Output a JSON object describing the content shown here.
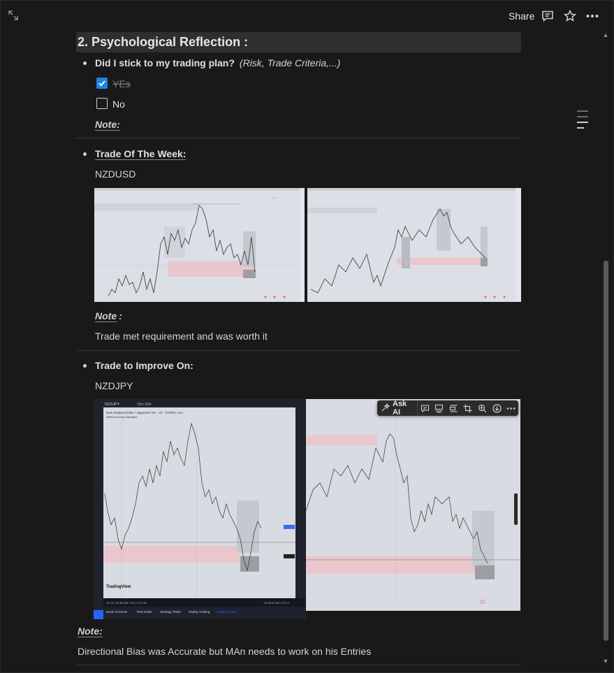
{
  "topbar": {
    "share_label": "Share",
    "icons": [
      "expand-icon",
      "comment-icon",
      "star-icon",
      "more-icon"
    ]
  },
  "section": {
    "heading": "2. Psychological Reflection :",
    "plan_question": {
      "label": "Did I stick to my trading plan?",
      "hint": "(Risk, Trade Criteria,...)"
    },
    "checklist": [
      {
        "label": "YEs",
        "checked": true
      },
      {
        "label": "No",
        "checked": false
      }
    ],
    "note1_label": "Note:",
    "trade_of_week": {
      "label": "Trade Of The Week:",
      "pair": "NZDUSD",
      "note_label": "Note",
      "note_colon": ":",
      "note_text": "Trade met requirement and was worth it"
    },
    "trade_to_improve": {
      "label": "Trade to Improve On:",
      "pair": "NZDJPY",
      "note_label": "Note:",
      "note_text": "Directional Bias was Accurate but MAn needs to work on his Entries"
    }
  },
  "image_toolbar": {
    "ask_ai_label": "Ask AI",
    "buttons": [
      "comment-icon",
      "caption-icon",
      "align-icon",
      "crop-icon",
      "zoom-icon",
      "download-icon",
      "more-icon"
    ]
  },
  "chart_screens": {
    "tv_symbol": "NZDJPY",
    "tv_title": "New Zealand Dollar / Japanese Yen · 1h · FOREX.com",
    "tv_subtitle": "Week and Day Separator",
    "tv_logo": "TradingView",
    "tv_bottom_tabs": [
      "Stock Screener",
      "Pine Editor",
      "Strategy Tester",
      "Replay Trading",
      "Trading Panel"
    ],
    "tv_timeframes": "1D  5D  1M  3M  6M  YTD  1Y  5Y  All",
    "tv_time": "09:38:40 AM UTC+1",
    "tv_top_intervals": "15m  30m"
  }
}
